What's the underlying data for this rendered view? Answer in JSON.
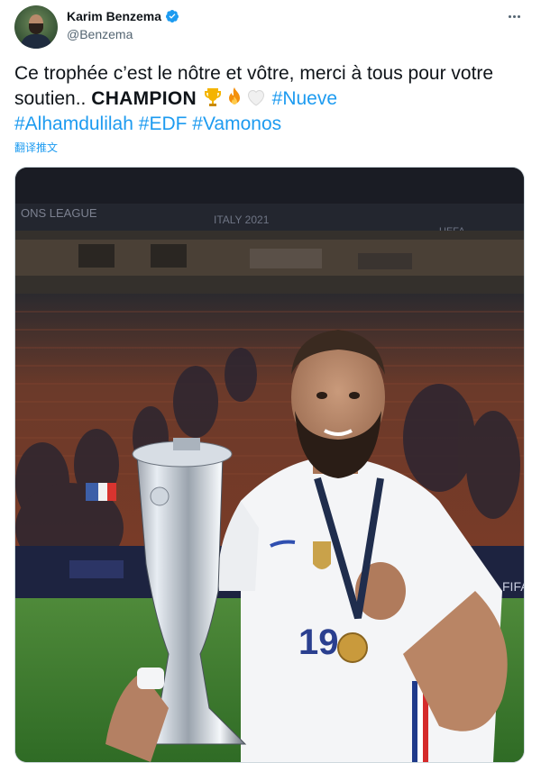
{
  "author": {
    "name": "Karim Benzema",
    "handle": "@Benzema"
  },
  "tweet": {
    "text_part1": "Ce trophée c’est le nôtre et vôtre, merci à tous pour votre soutien.. ",
    "champion": "CHAMPION",
    "hashtags": [
      "#Nueve",
      "#Alhamdulilah",
      "#EDF",
      "#Vamonos"
    ],
    "emojis": [
      "trophy-emoji",
      "fire-emoji",
      "white-heart-emoji"
    ]
  },
  "translate_label": "翻译推文",
  "photo": {
    "jersey_number": "19",
    "banner_left": "ONS LEAGUE",
    "banner_center": "ITALY 2021",
    "banner_right": "UEFA",
    "board_right": "FIFA"
  },
  "colors": {
    "link": "#1d9bf0",
    "verified": "#1d9bf0",
    "secondary_text": "#536471"
  }
}
